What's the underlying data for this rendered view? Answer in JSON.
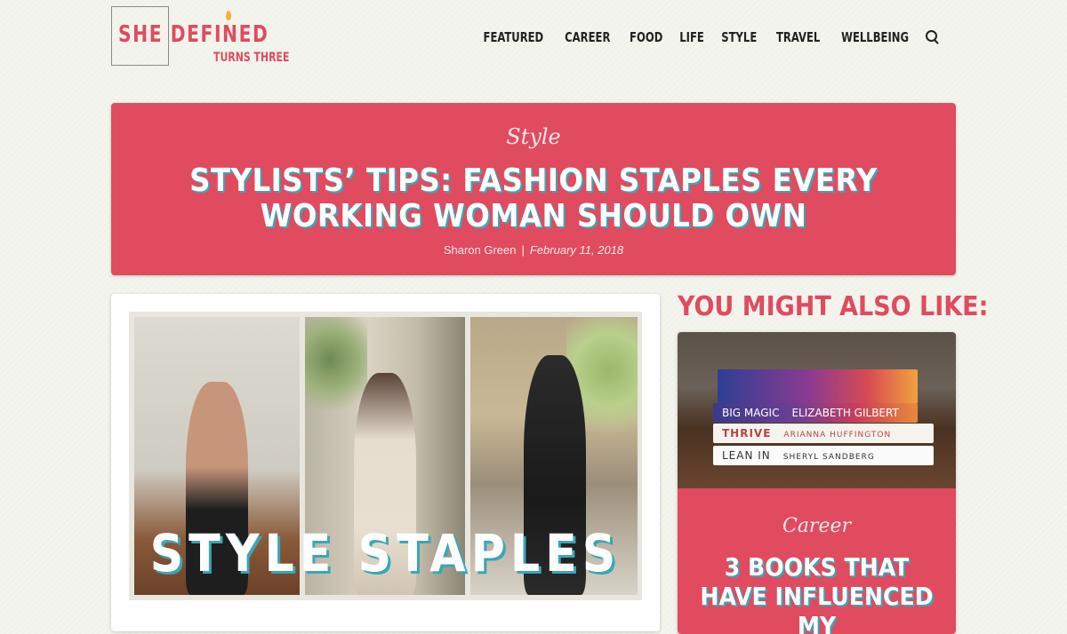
{
  "brand": {
    "name": "SHE DEFINED",
    "tagline": "TURNS THREE"
  },
  "nav": {
    "items": [
      "FEATURED",
      "CAREER",
      "FOOD",
      "LIFE",
      "STYLE",
      "TRAVEL",
      "WELLBEING"
    ],
    "search_icon": "search-icon"
  },
  "article": {
    "category": "Style",
    "title": "STYLISTS’ TIPS: FASHION STAPLES EVERY WORKING WOMAN SHOULD OWN",
    "author": "Sharon Green",
    "separator": "|",
    "date": "February 11, 2018",
    "image_overlay_text": "STYLE STAPLES"
  },
  "sidebar": {
    "heading": "YOU MIGHT ALSO LIKE:",
    "related": [
      {
        "category": "Career",
        "title": "3 BOOKS THAT HAVE INFLUENCED MY",
        "books": [
          {
            "title": "BIG MAGIC",
            "author": "ELIZABETH GILBERT"
          },
          {
            "title": "THRIVE",
            "author": "ARIANNA HUFFINGTON"
          },
          {
            "title": "LEAN IN",
            "author": "SHERYL SANDBERG"
          }
        ]
      }
    ]
  },
  "colors": {
    "accent": "#e04b5f",
    "shadow_teal": "#3aa6b9",
    "background": "#f1f2ea"
  }
}
